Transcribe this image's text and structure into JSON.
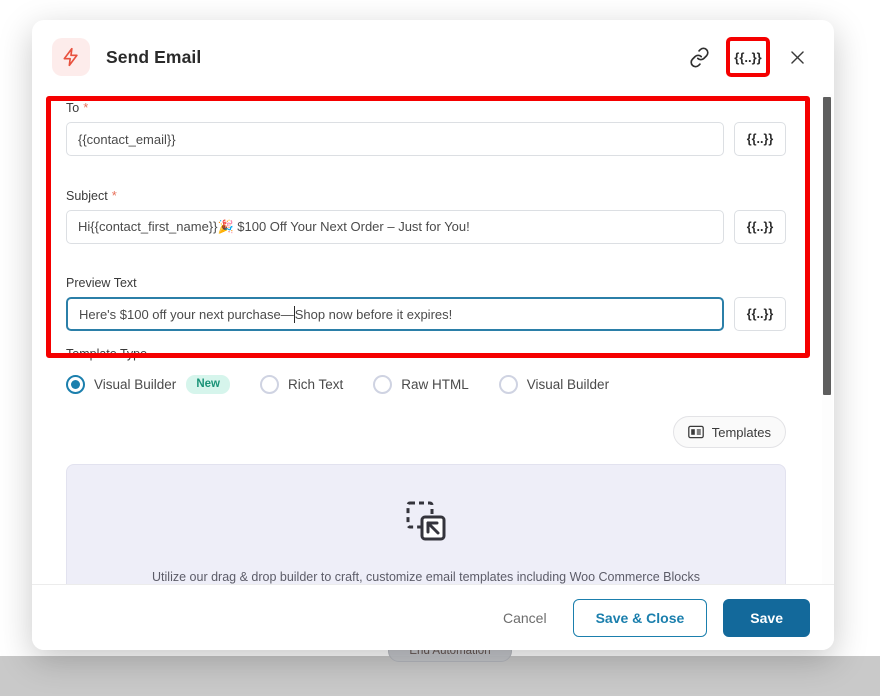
{
  "backdrop": {
    "end_automation_label": "End Automation"
  },
  "modal": {
    "title": "Send Email",
    "app_icon": "lightning-bolt-icon",
    "header_actions": {
      "link_label": "link-icon",
      "token_label": "{{..}}",
      "close_label": "×"
    },
    "fields": [
      {
        "label": "To",
        "required": true,
        "value": "{{contact_email}}",
        "placeholder": "",
        "token_label": "{{..}}",
        "focused": false
      },
      {
        "label": "Subject",
        "required": true,
        "value": "Hi{{contact_first_name}}🎉 $100 Off Your Next Order – Just for You!",
        "placeholder": "",
        "token_label": "{{..}}",
        "focused": false
      },
      {
        "label": "Preview Text",
        "required": false,
        "value_before_caret": "Here's $100 off your next purchase—",
        "value_after_caret": "Shop now before it expires!",
        "value": "Here's $100 off your next purchase—Shop now before it expires!",
        "placeholder": "",
        "token_label": "{{..}}",
        "focused": true
      }
    ],
    "template_type": {
      "label": "Template Type",
      "options": [
        {
          "label": "Visual Builder",
          "checked": true,
          "badge": "New"
        },
        {
          "label": "Rich Text",
          "checked": false,
          "badge": ""
        },
        {
          "label": "Raw HTML",
          "checked": false,
          "badge": ""
        },
        {
          "label": "Visual Builder",
          "checked": false,
          "badge": ""
        }
      ]
    },
    "templates_button": {
      "label": "Templates",
      "icon": "template-grid-icon"
    },
    "builder": {
      "icon": "drag-and-drop-icon",
      "caption": "Utilize our drag & drop builder to craft, customize email templates including Woo Commerce Blocks"
    },
    "footer": {
      "cancel_label": "Cancel",
      "save_close_label": "Save & Close",
      "save_label": "Save"
    },
    "scrollbar": {
      "thumb_position": "top"
    }
  },
  "colors": {
    "highlight": "#f50000",
    "accent": "#13699b",
    "accent_outline": "#1b7fad",
    "brand_icon": "#e8523f",
    "badge_bg": "#d6f5ec",
    "badge_text": "#1a9478",
    "builder_bg": "#eeeef8"
  }
}
